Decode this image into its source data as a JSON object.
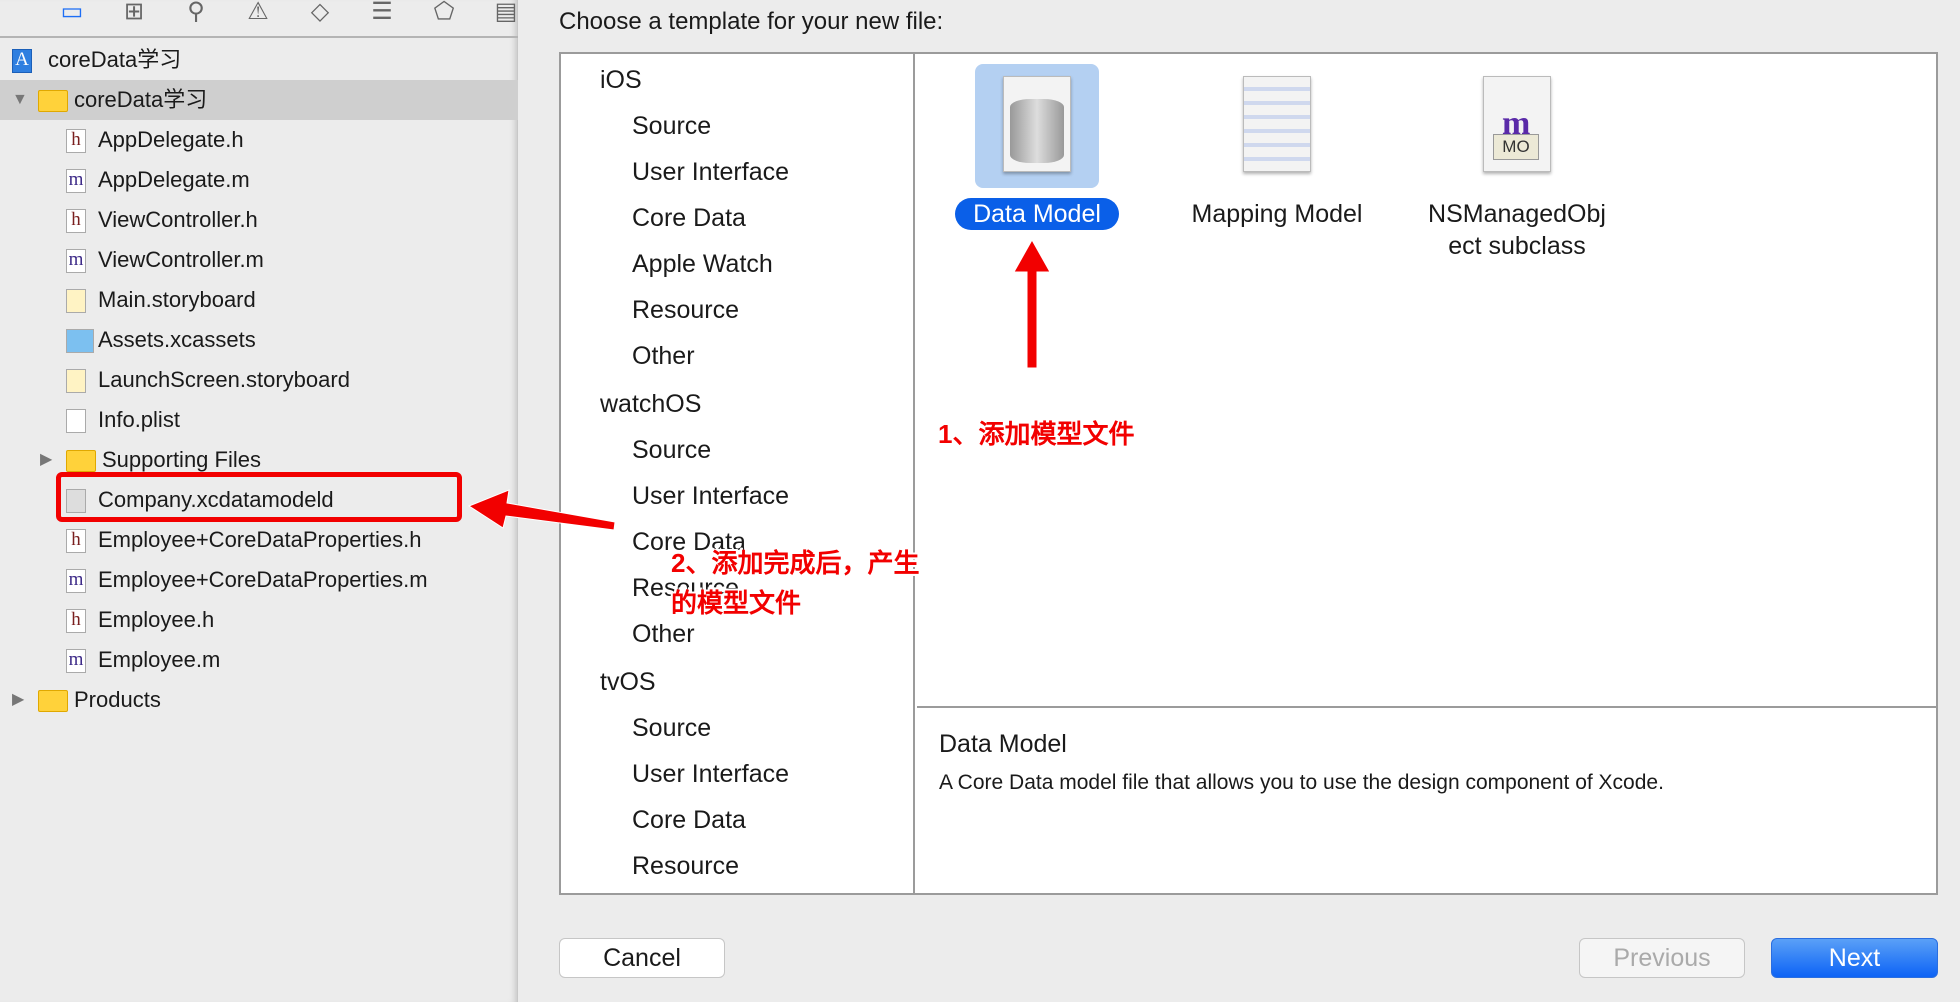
{
  "navigator": {
    "toolbar_icons": [
      "project-navigator-icon",
      "hierarchy-icon",
      "search-icon",
      "warning-icon",
      "breakpoint-icon",
      "report-icon",
      "tag-icon",
      "comment-icon"
    ],
    "items": [
      {
        "label": "coreData学习",
        "icon": "project-icon",
        "indent": 0,
        "disclosure": "none"
      },
      {
        "label": "coreData学习",
        "icon": "folder-icon",
        "indent": 1,
        "disclosure": "open",
        "selected": true
      },
      {
        "label": "AppDelegate.h",
        "icon": "h",
        "indent": 2
      },
      {
        "label": "AppDelegate.m",
        "icon": "m",
        "indent": 2
      },
      {
        "label": "ViewController.h",
        "icon": "h",
        "indent": 2
      },
      {
        "label": "ViewController.m",
        "icon": "m",
        "indent": 2
      },
      {
        "label": "Main.storyboard",
        "icon": "storyboard",
        "indent": 2
      },
      {
        "label": "Assets.xcassets",
        "icon": "assets",
        "indent": 2
      },
      {
        "label": "LaunchScreen.storyboard",
        "icon": "storyboard",
        "indent": 2
      },
      {
        "label": "Info.plist",
        "icon": "plist",
        "indent": 2
      },
      {
        "label": "Supporting Files",
        "icon": "folder-icon",
        "indent": 2,
        "disclosure": "closed"
      },
      {
        "label": "Company.xcdatamodeld",
        "icon": "datamodel",
        "indent": 2,
        "highlighted": true
      },
      {
        "label": "Employee+CoreDataProperties.h",
        "icon": "h",
        "indent": 2
      },
      {
        "label": "Employee+CoreDataProperties.m",
        "icon": "m",
        "indent": 2
      },
      {
        "label": "Employee.h",
        "icon": "h",
        "indent": 2
      },
      {
        "label": "Employee.m",
        "icon": "m",
        "indent": 2
      },
      {
        "label": "Products",
        "icon": "folder-icon",
        "indent": 1,
        "disclosure": "closed"
      }
    ]
  },
  "dialog": {
    "title": "Choose a template for your new file:",
    "categories": [
      {
        "label": "iOS",
        "header": true
      },
      {
        "label": "Source"
      },
      {
        "label": "User Interface"
      },
      {
        "label": "Core Data"
      },
      {
        "label": "Apple Watch"
      },
      {
        "label": "Resource"
      },
      {
        "label": "Other"
      },
      {
        "label": "watchOS",
        "header": true
      },
      {
        "label": "Source"
      },
      {
        "label": "User Interface"
      },
      {
        "label": "Core Data"
      },
      {
        "label": "Resource"
      },
      {
        "label": "Other"
      },
      {
        "label": "tvOS",
        "header": true
      },
      {
        "label": "Source"
      },
      {
        "label": "User Interface"
      },
      {
        "label": "Core Data"
      },
      {
        "label": "Resource"
      }
    ],
    "templates": [
      {
        "label": "Data Model",
        "selected": true
      },
      {
        "label": "Mapping Model"
      },
      {
        "label": "NSManagedObj\nect subclass",
        "badge": "MO",
        "glyph": "m"
      }
    ],
    "description": {
      "title": "Data Model",
      "text": "A Core Data model file that allows you to use the design component of Xcode."
    },
    "buttons": {
      "cancel": "Cancel",
      "previous": "Previous",
      "next": "Next"
    }
  },
  "annotations": {
    "a1": "1、添加模型文件",
    "a2_line1": "2、添加完成后，产生",
    "a2_line2": "的模型文件"
  },
  "colors": {
    "accent": "#0a5fe8",
    "annotation": "#f20000",
    "selection": "#b4d0f2"
  }
}
